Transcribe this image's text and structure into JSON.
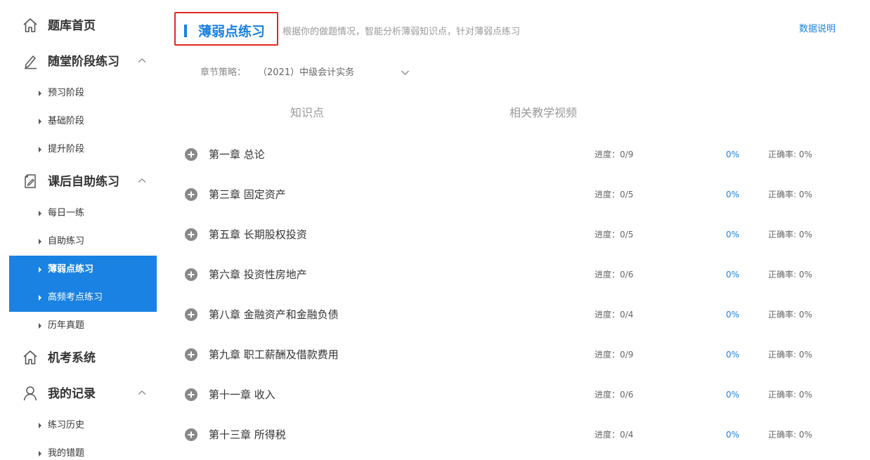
{
  "sidebar": {
    "groups": [
      {
        "label": "题库首页",
        "icon": "home-icon"
      },
      {
        "label": "随堂阶段练习",
        "icon": "pen-icon",
        "items": [
          "预习阶段",
          "基础阶段",
          "提升阶段"
        ]
      },
      {
        "label": "课后自助练习",
        "icon": "note-edit-icon",
        "items": [
          "每日一练",
          "自助练习",
          "薄弱点练习",
          "高频考点练习",
          "历年真题"
        ]
      },
      {
        "label": "机考系统",
        "icon": "home-icon"
      },
      {
        "label": "我的记录",
        "icon": "user-icon",
        "items": [
          "练习历史",
          "我的错题"
        ]
      }
    ]
  },
  "header": {
    "title": "薄弱点练习",
    "description": "根据你的做题情况，智能分析薄弱知识点，针对薄弱点练习",
    "data_link": "数据说明"
  },
  "filter": {
    "label": "章节策略：",
    "value": "（2021）中级会计实务"
  },
  "tabs": [
    "知识点",
    "相关教学视频"
  ],
  "progress_prefix": "进度：",
  "accuracy_prefix": "正确率: ",
  "chapters": [
    {
      "name": "第一章 总论",
      "progress": "0/9",
      "percent": "0%",
      "accuracy": "0%"
    },
    {
      "name": "第三章 固定资产",
      "progress": "0/5",
      "percent": "0%",
      "accuracy": "0%"
    },
    {
      "name": "第五章 长期股权投资",
      "progress": "0/5",
      "percent": "0%",
      "accuracy": "0%"
    },
    {
      "name": "第六章 投资性房地产",
      "progress": "0/6",
      "percent": "0%",
      "accuracy": "0%"
    },
    {
      "name": "第八章 金融资产和金融负债",
      "progress": "0/4",
      "percent": "0%",
      "accuracy": "0%"
    },
    {
      "name": "第九章 职工薪酬及借款费用",
      "progress": "0/9",
      "percent": "0%",
      "accuracy": "0%"
    },
    {
      "name": "第十一章 收入",
      "progress": "0/6",
      "percent": "0%",
      "accuracy": "0%"
    },
    {
      "name": "第十三章 所得税",
      "progress": "0/4",
      "percent": "0%",
      "accuracy": "0%"
    }
  ],
  "colors": {
    "accent": "#1a82e2",
    "highlight_border": "#e3271f"
  }
}
